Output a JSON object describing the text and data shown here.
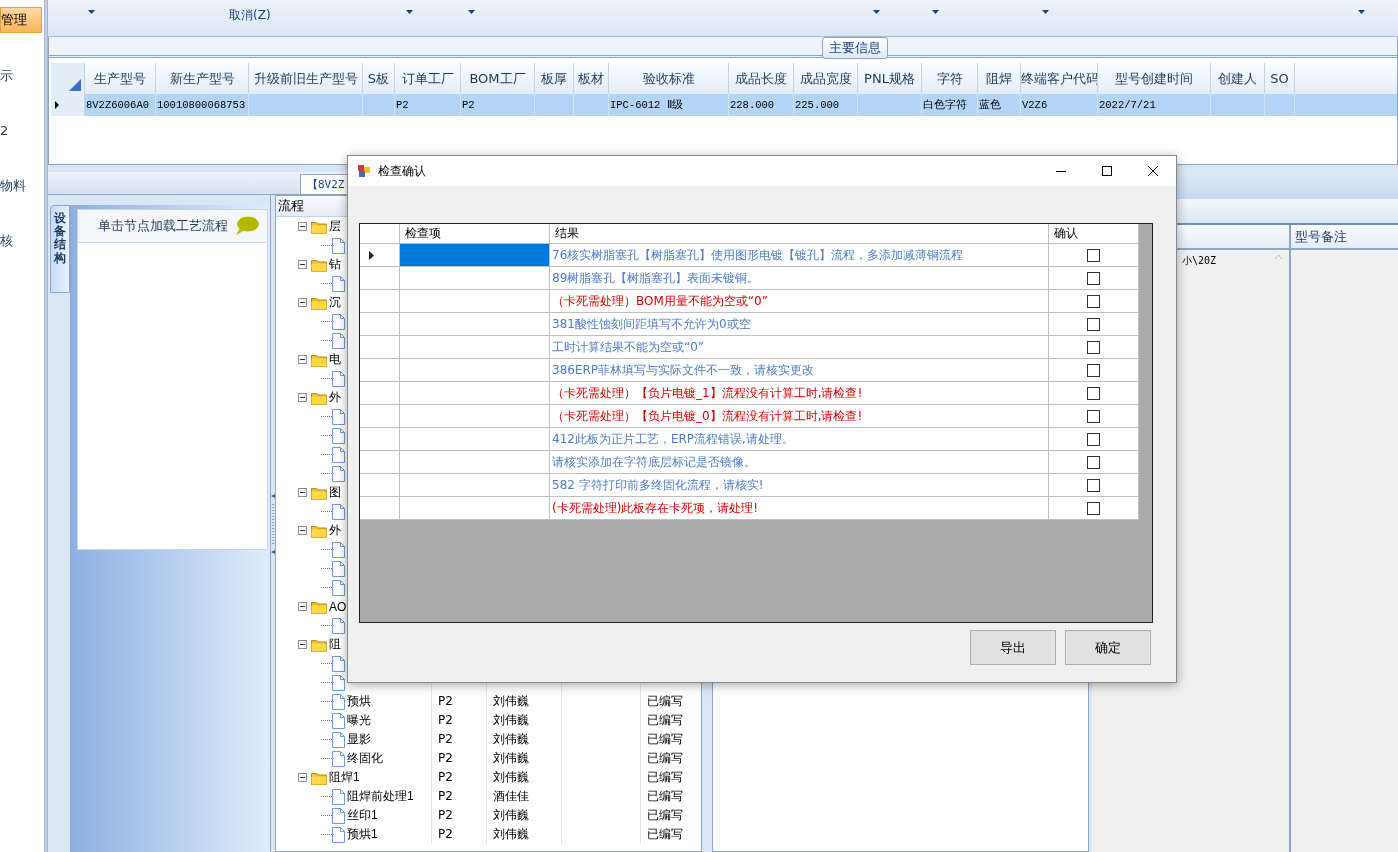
{
  "nav": {
    "items": [
      {
        "label": "管理",
        "selected": true
      },
      {
        "label": "示",
        "selected": false
      },
      {
        "label": "2",
        "selected": false
      },
      {
        "label": "物料",
        "selected": false
      },
      {
        "label": "核",
        "selected": false
      }
    ]
  },
  "toolbar": {
    "items": [
      {
        "kind": "dropdown"
      },
      {
        "kind": "text",
        "label": "取消(Z)"
      },
      {
        "kind": "dropdown"
      },
      {
        "kind": "dropdown"
      },
      {
        "kind": "dropdown"
      },
      {
        "kind": "dropdown"
      },
      {
        "kind": "dropdown"
      },
      {
        "kind": "dropdown"
      }
    ]
  },
  "main_info": {
    "title": "主要信息",
    "columns": [
      "生产型号",
      "新生产型号",
      "升级前旧生产型号",
      "S板",
      "订单工厂",
      "BOM工厂",
      "板厚",
      "板材",
      "验收标准",
      "成品长度",
      "成品宽度",
      "PNL规格",
      "字符",
      "阻焊",
      "终端客户代码",
      "型号创建时间",
      "创建人",
      "SO"
    ],
    "rows": [
      {
        "selected": true,
        "cells": [
          "8V2Z6006A0",
          "10010800068753",
          null,
          null,
          "P2",
          "P2",
          null,
          null,
          "IPC-6012 Ⅱ级",
          "228.000",
          "225.000",
          null,
          "白色字符",
          "蓝色",
          "V2Z6",
          "2022/7/21",
          null,
          null
        ]
      }
    ]
  },
  "lower_tab": {
    "label": "【8V2Z"
  },
  "device_panel": {
    "tab": "设备结构",
    "hint": "单击节点加载工艺流程"
  },
  "tree": {
    "header": "流程",
    "nodes": [
      {
        "kind": "folder",
        "label": "层",
        "expanded": true,
        "children": [
          {
            "kind": "file"
          }
        ]
      },
      {
        "kind": "folder",
        "label": "钻",
        "expanded": true,
        "children": [
          {
            "kind": "file"
          }
        ]
      },
      {
        "kind": "folder",
        "label": "沉",
        "expanded": true,
        "children": [
          {
            "kind": "file"
          },
          {
            "kind": "file"
          }
        ]
      },
      {
        "kind": "folder",
        "label": "电",
        "expanded": true,
        "children": [
          {
            "kind": "file"
          }
        ]
      },
      {
        "kind": "folder",
        "label": "外",
        "expanded": true,
        "children": [
          {
            "kind": "file"
          },
          {
            "kind": "file"
          },
          {
            "kind": "file"
          },
          {
            "kind": "file"
          }
        ]
      },
      {
        "kind": "folder",
        "label": "图",
        "expanded": true,
        "children": [
          {
            "kind": "file"
          }
        ]
      },
      {
        "kind": "folder",
        "label": "外",
        "expanded": true,
        "children": [
          {
            "kind": "file"
          },
          {
            "kind": "file"
          },
          {
            "kind": "file"
          }
        ]
      },
      {
        "kind": "folder",
        "label": "AO",
        "expanded": true,
        "children": [
          {
            "kind": "file"
          }
        ]
      },
      {
        "kind": "folder",
        "label": "阻",
        "expanded": true,
        "children": [
          {
            "kind": "file"
          },
          {
            "kind": "file"
          },
          {
            "kind": "file",
            "label": "预烘",
            "cells": [
              "P2",
              "刘伟巍",
              null,
              "已编写"
            ]
          },
          {
            "kind": "file",
            "label": "曝光",
            "cells": [
              "P2",
              "刘伟巍",
              null,
              "已编写"
            ]
          },
          {
            "kind": "file",
            "label": "显影",
            "cells": [
              "P2",
              "刘伟巍",
              null,
              "已编写"
            ]
          },
          {
            "kind": "file",
            "label": "终固化",
            "cells": [
              "P2",
              "刘伟巍",
              null,
              "已编写"
            ]
          }
        ]
      },
      {
        "kind": "folder",
        "label": "阻焊1",
        "expanded": true,
        "cells": [
          "P2",
          "刘伟巍",
          null,
          "已编写"
        ],
        "children": [
          {
            "kind": "file",
            "label": "阻焊前处理1",
            "cells": [
              "P2",
              "酒佳佳",
              null,
              "已编写"
            ]
          },
          {
            "kind": "file",
            "label": "丝印1",
            "cells": [
              "P2",
              "刘伟巍",
              null,
              "已编写"
            ]
          },
          {
            "kind": "file",
            "label": "预烘1",
            "cells": [
              "P2",
              "刘伟巍",
              null,
              "已编写"
            ]
          }
        ]
      }
    ]
  },
  "right_panel": {
    "text": "小\\20Z",
    "header": "型号备注"
  },
  "dialog": {
    "title": "检查确认",
    "columns": [
      "检查项",
      "结果",
      "确认"
    ],
    "rows": [
      {
        "selected": true,
        "result": "76核实树脂塞孔【树脂塞孔】使用图形电镀【镀孔】流程，多添加减薄铜流程",
        "color": "#4f7cc4",
        "checked": false
      },
      {
        "selected": false,
        "result": "89树脂塞孔【树脂塞孔】表面未镀铜。",
        "color": "#4f7cc4",
        "checked": false
      },
      {
        "selected": false,
        "result": "（卡死需处理）BOM用量不能为空或“0”",
        "color": "#dd0000",
        "checked": false
      },
      {
        "selected": false,
        "result": "381酸性蚀刻间距填写不允许为0或空",
        "color": "#4f7cc4",
        "checked": false
      },
      {
        "selected": false,
        "result": "工时计算结果不能为空或“0”",
        "color": "#4f7cc4",
        "checked": false
      },
      {
        "selected": false,
        "result": "386ERP菲林填写与实际文件不一致，请核实更改",
        "color": "#4f7cc4",
        "checked": false
      },
      {
        "selected": false,
        "result": "（卡死需处理）【负片电镀_1】流程没有计算工时,请检查!",
        "color": "#dd0000",
        "checked": false
      },
      {
        "selected": false,
        "result": "（卡死需处理）【负片电镀_0】流程没有计算工时,请检查!",
        "color": "#dd0000",
        "checked": false
      },
      {
        "selected": false,
        "result": "412此板为正片工艺，ERP流程错误,请处理。",
        "color": "#4f7cc4",
        "checked": false
      },
      {
        "selected": false,
        "result": "请核实添加在字符底层标记是否镜像。",
        "color": "#4f7cc4",
        "checked": false
      },
      {
        "selected": false,
        "result": "582 字符打印前多终固化流程，请核实!",
        "color": "#4f7cc4",
        "checked": false
      },
      {
        "selected": false,
        "result": "(卡死需处理)此板存在卡死项，请处理!",
        "color": "#dd0000",
        "checked": false
      }
    ],
    "buttons": [
      "导出",
      "确定"
    ]
  }
}
